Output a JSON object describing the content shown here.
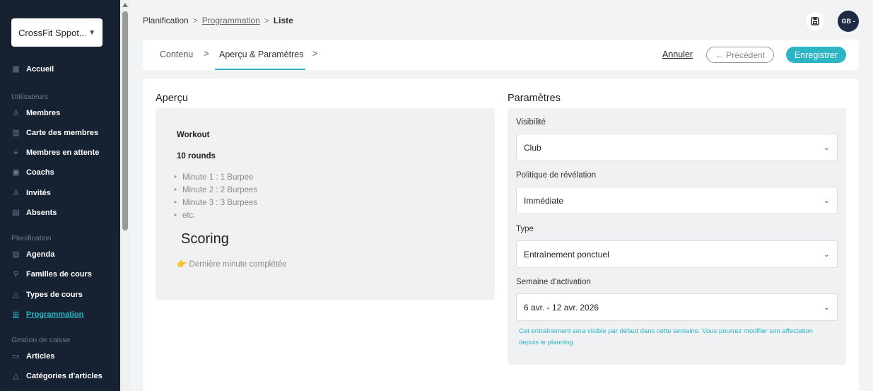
{
  "sidebar": {
    "club_select": "CrossFit Sppot...",
    "items": [
      {
        "label": "Accueil",
        "icon": "grid-icon"
      },
      {
        "group": "Utilisateurs"
      },
      {
        "label": "Membres",
        "icon": "user-icon"
      },
      {
        "label": "Carte des membres",
        "icon": "map-icon"
      },
      {
        "label": "Membres en attente",
        "icon": "user-list-icon"
      },
      {
        "label": "Coachs",
        "icon": "coach-icon"
      },
      {
        "label": "Invités",
        "icon": "user-plus-icon"
      },
      {
        "label": "Absents",
        "icon": "calendar-x-icon"
      },
      {
        "group": "Planification"
      },
      {
        "label": "Agenda",
        "icon": "calendar-icon"
      },
      {
        "label": "Familles de cours",
        "icon": "hierarchy-icon"
      },
      {
        "label": "Types de cours",
        "icon": "shapes-icon"
      },
      {
        "label": "Programmation",
        "icon": "program-icon",
        "active": true
      },
      {
        "group": "Gestion de caisse"
      },
      {
        "label": "Articles",
        "icon": "box-icon"
      },
      {
        "label": "Catégories d'articles",
        "icon": "shapes-icon"
      }
    ]
  },
  "breadcrumb": {
    "root": "Planification",
    "sep": ">",
    "link": "Programmation",
    "current": "Liste"
  },
  "avatar": "GB -",
  "tabs": {
    "content": "Contenu",
    "preview": "Aperçu & Paramètres",
    "arrow": ">"
  },
  "actions": {
    "cancel": "Annuler",
    "previous": "← Précédent",
    "save": "Enregistrer"
  },
  "preview": {
    "title": "Aperçu",
    "workout": "Workout",
    "rounds": "10 rounds",
    "list": [
      "Minute 1 : 1 Burpee",
      "Minute 2 : 2 Burpees",
      "Minute 3 : 3 Burpees",
      "etc."
    ],
    "scoring": "Scoring",
    "last_minute": "👉 Dernière minute complétée"
  },
  "params": {
    "title": "Paramètres",
    "visibility_label": "Visibilité",
    "visibility_value": "Club",
    "reveal_label": "Politique de révélation",
    "reveal_value": "Immédiate",
    "type_label": "Type",
    "type_value": "Entraînement ponctuel",
    "week_label": "Semaine d'activation",
    "week_value": "6 avr. - 12 avr. 2026",
    "help": "Cet entraînement sera visible par défaut dans cette semaine. Vous pourrez modifier son affectation depuis le planning."
  },
  "colors": {
    "sidebar_bg": "#162231",
    "accent": "#2bb5c5"
  }
}
